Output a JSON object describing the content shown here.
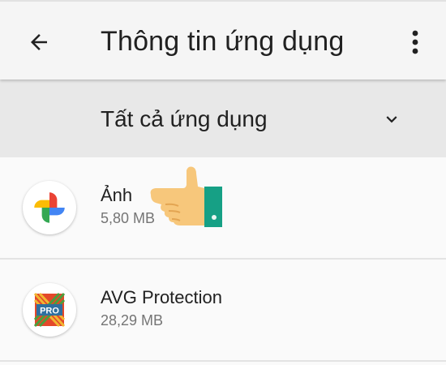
{
  "header": {
    "title": "Thông tin ứng dụng",
    "back_icon": "arrow-back-icon",
    "more_icon": "more-vert-icon"
  },
  "filter": {
    "selected": "Tất cả ứng dụng",
    "icon": "chevron-down-icon"
  },
  "apps": [
    {
      "name": "Ảnh",
      "size": "5,80 MB",
      "icon": "google-photos-icon"
    },
    {
      "name": "AVG Protection",
      "size": "28,29 MB",
      "icon": "avg-protection-icon"
    }
  ],
  "overlay": {
    "icon": "pointing-hand-icon"
  },
  "colors": {
    "appbar_bg": "#f5f5f5",
    "filterbar_bg": "#e8e8e8",
    "list_bg": "#fafafa",
    "text_primary": "#212121",
    "text_secondary": "#757575",
    "cuff": "#16a085",
    "skin": "#f7c77b"
  }
}
